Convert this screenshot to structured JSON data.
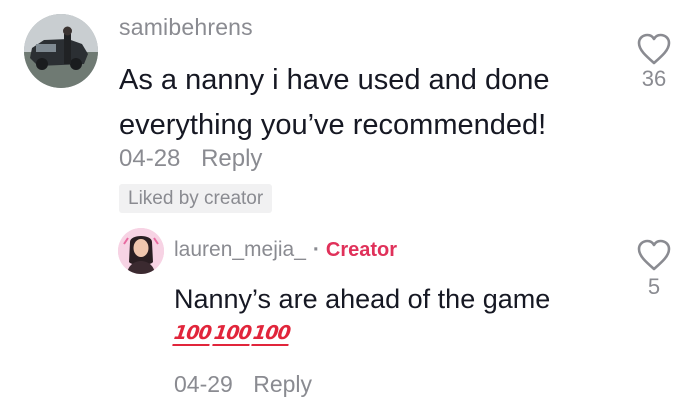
{
  "comment": {
    "username": "samibehrens",
    "text": "As a nanny i have used and done everything you’ve recommended!",
    "date": "04-28",
    "reply_label": "Reply",
    "liked_badge": "Liked by creator",
    "like_count": "36",
    "like_icon": "heart-outline-icon"
  },
  "reply": {
    "username": "lauren_mejia_",
    "separator": "·",
    "creator_label": "Creator",
    "text": "Nanny’s are ahead of the game",
    "emojis": [
      "100",
      "100",
      "100"
    ],
    "date": "04-29",
    "reply_label": "Reply",
    "like_count": "5",
    "like_icon": "heart-outline-icon"
  },
  "colors": {
    "primary_text": "#161823",
    "secondary_text": "#8a8b91",
    "creator_accent": "#e0315a",
    "badge_bg": "#f1f1f2"
  }
}
